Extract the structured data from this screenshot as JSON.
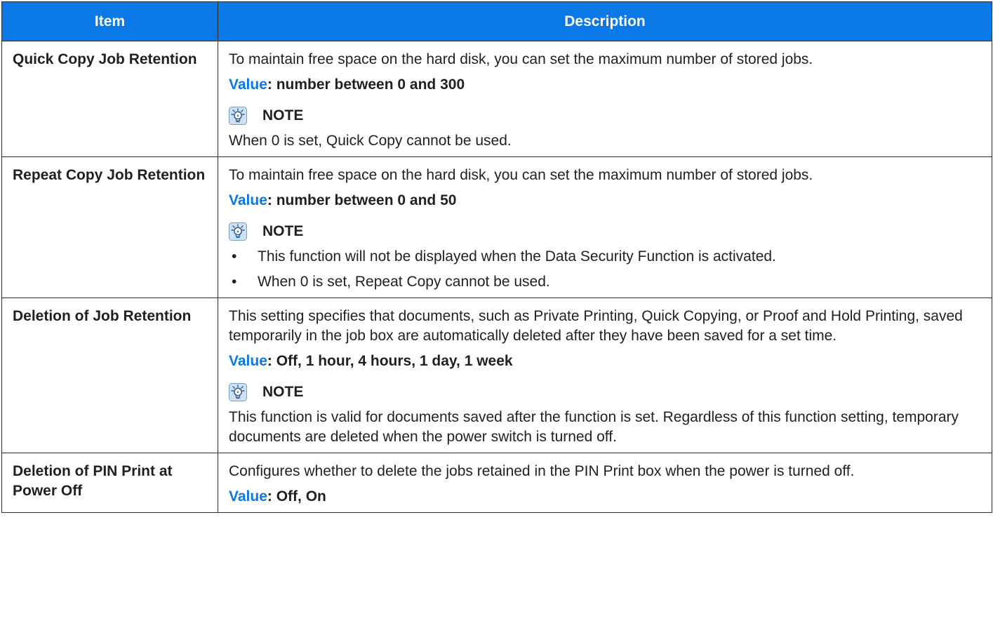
{
  "header": {
    "item": "Item",
    "description": "Description"
  },
  "rows": [
    {
      "item": "Quick Copy Job Retention",
      "desc": "To maintain free space on the hard disk, you can set the maximum number of stored jobs.",
      "value_label": "Value",
      "value_text": ": number between 0 and 300",
      "note_label": "NOTE",
      "note_text": "When 0 is set, Quick Copy cannot be used."
    },
    {
      "item": "Repeat Copy Job Retention",
      "desc": "To maintain free space on the hard disk, you can set the maximum number of stored jobs.",
      "value_label": "Value",
      "value_text": ": number between 0 and 50",
      "note_label": "NOTE",
      "note_bullets": [
        "This function will not be displayed when the Data Security Function is activated.",
        "When 0 is set, Repeat Copy cannot be used."
      ]
    },
    {
      "item": "Deletion of Job Retention",
      "desc": "This setting specifies that documents, such as Private Printing, Quick Copying, or Proof and Hold Printing, saved temporarily in the job box are automatically deleted after they have been saved for a set time.",
      "value_label": "Value",
      "value_text": ": Off, 1 hour, 4 hours, 1 day, 1 week",
      "note_label": "NOTE",
      "note_text": "This function is valid for documents saved after the function is set. Regardless of this function setting, temporary documents are deleted when the power switch is turned off."
    },
    {
      "item": "Deletion of PIN Print at Power Off",
      "desc": "Configures whether to delete the jobs retained in the PIN Print box when the power is turned off.",
      "value_label": "Value",
      "value_text": ": Off, On"
    }
  ],
  "bullet_glyph": "•",
  "colors": {
    "header_bg": "#0a78e6",
    "value_label": "#0a78e6",
    "border": "#2a2a2a"
  },
  "icons": {
    "note": "lightbulb-note-icon"
  }
}
